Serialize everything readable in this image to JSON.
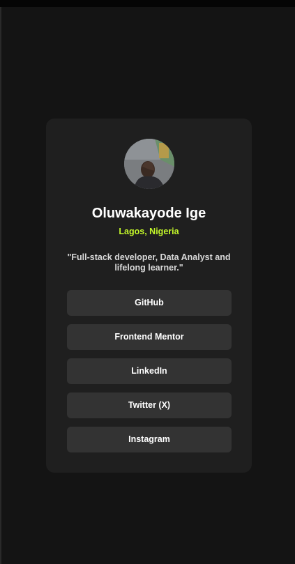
{
  "profile": {
    "name": "Oluwakayode Ige",
    "location": "Lagos, Nigeria",
    "bio": "\"Full-stack developer, Data Analyst and lifelong learner.\"",
    "avatar_alt": "Profile photo"
  },
  "links": [
    {
      "label": "GitHub"
    },
    {
      "label": "Frontend Mentor"
    },
    {
      "label": "LinkedIn"
    },
    {
      "label": "Twitter (X)"
    },
    {
      "label": "Instagram"
    }
  ],
  "colors": {
    "background": "#141414",
    "card": "#1f1f1f",
    "button": "#333333",
    "accent": "#c4f82a",
    "text": "#ffffff"
  }
}
